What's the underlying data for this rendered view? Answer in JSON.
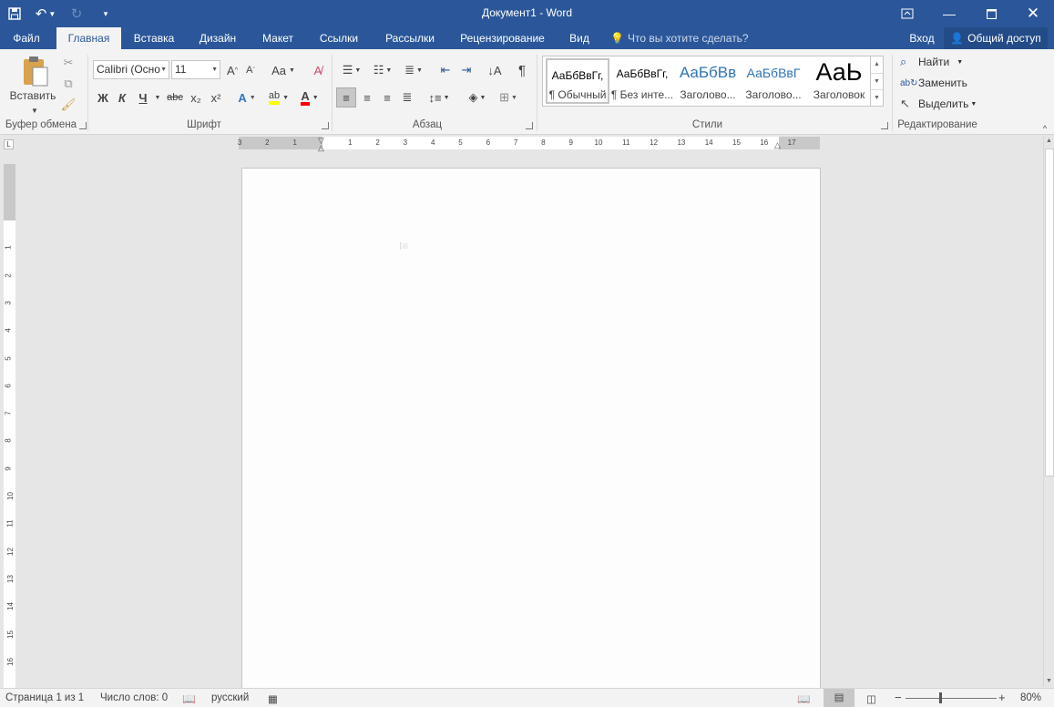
{
  "window": {
    "title": "Документ1 - Word"
  },
  "qat": {
    "save_icon": "save-icon",
    "undo_icon": "undo-icon",
    "redo_icon": "redo-icon",
    "customize_icon": "customize-qat-icon"
  },
  "tabs": [
    {
      "label": "Файл"
    },
    {
      "label": "Главная"
    },
    {
      "label": "Вставка"
    },
    {
      "label": "Дизайн"
    },
    {
      "label": "Макет"
    },
    {
      "label": "Ссылки"
    },
    {
      "label": "Рассылки"
    },
    {
      "label": "Рецензирование"
    },
    {
      "label": "Вид"
    }
  ],
  "tell_me": {
    "placeholder": "Что вы хотите сделать?"
  },
  "account": {
    "signin": "Вход",
    "share": "Общий доступ"
  },
  "ribbon": {
    "clipboard": {
      "paste": "Вставить",
      "label": "Буфер обмена"
    },
    "font": {
      "name": "Calibri (Осно",
      "size": "11",
      "label": "Шрифт",
      "bold": "Ж",
      "italic": "К",
      "underline": "Ч",
      "strike": "abc",
      "sub": "x₂",
      "sup": "x²",
      "case": "Aa",
      "grow": "A",
      "shrink": "A"
    },
    "paragraph": {
      "label": "Абзац",
      "pilcrow": "¶"
    },
    "styles": {
      "label": "Стили",
      "items": [
        {
          "preview": "АаБбВвГг,",
          "name": "¶ Обычный"
        },
        {
          "preview": "АаБбВвГг,",
          "name": "¶ Без инте..."
        },
        {
          "preview": "АаБбВв",
          "name": "Заголово..."
        },
        {
          "preview": "АаБбВвГ",
          "name": "Заголово..."
        },
        {
          "preview": "АаЬ",
          "name": "Заголовок"
        }
      ]
    },
    "editing": {
      "label": "Редактирование",
      "find": "Найти",
      "replace": "Заменить",
      "select": "Выделить"
    }
  },
  "ruler": {
    "marks": [
      "3",
      "2",
      "1",
      "1",
      "2",
      "3",
      "4",
      "5",
      "6",
      "7",
      "8",
      "9",
      "10",
      "11",
      "12",
      "13",
      "14",
      "15",
      "16",
      "17"
    ]
  },
  "status": {
    "page": "Страница 1 из 1",
    "words": "Число слов: 0",
    "language": "русский",
    "zoom": "80%"
  },
  "colors": {
    "accent": "#2b579a",
    "highlight": "#ffff00",
    "font_color": "#ff0000"
  }
}
